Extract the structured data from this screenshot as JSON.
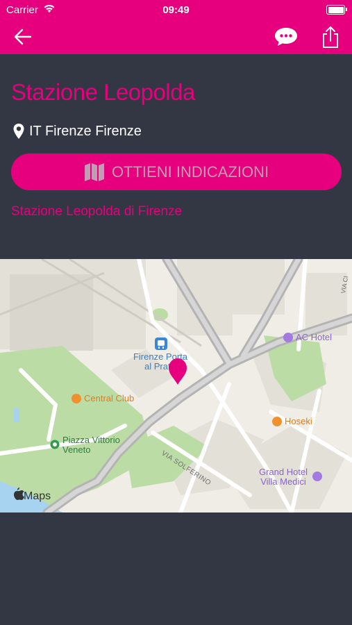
{
  "status_bar": {
    "carrier": "Carrier",
    "time": "09:49"
  },
  "nav": {
    "back_icon": "arrow-left-icon",
    "chat_icon": "chat-bubble-icon",
    "share_icon": "share-icon"
  },
  "place": {
    "title": "Stazione Leopolda",
    "location": "IT Firenze Firenze",
    "directions_label": "OTTIENI INDICAZIONI",
    "description": "Stazione Leopolda di Firenze"
  },
  "map": {
    "attribution": "Maps",
    "labels": {
      "station_line1": "Firenze Porta",
      "station_line2": "al Prato",
      "central_club": "Central Club",
      "ac_hotel": "AC Hotel",
      "hoseki": "Hoseki",
      "piazza_line1": "Piazza Vittorio",
      "piazza_line2": "Veneto",
      "via_solferino": "VIA SOLFERINO",
      "grand_hotel_line1": "Grand Hotel",
      "grand_hotel_line2": "Villa Medici",
      "via_ci": "VIA CI"
    }
  },
  "colors": {
    "accent": "#e6007e",
    "background": "#333744",
    "button_text": "#c29bb4"
  }
}
